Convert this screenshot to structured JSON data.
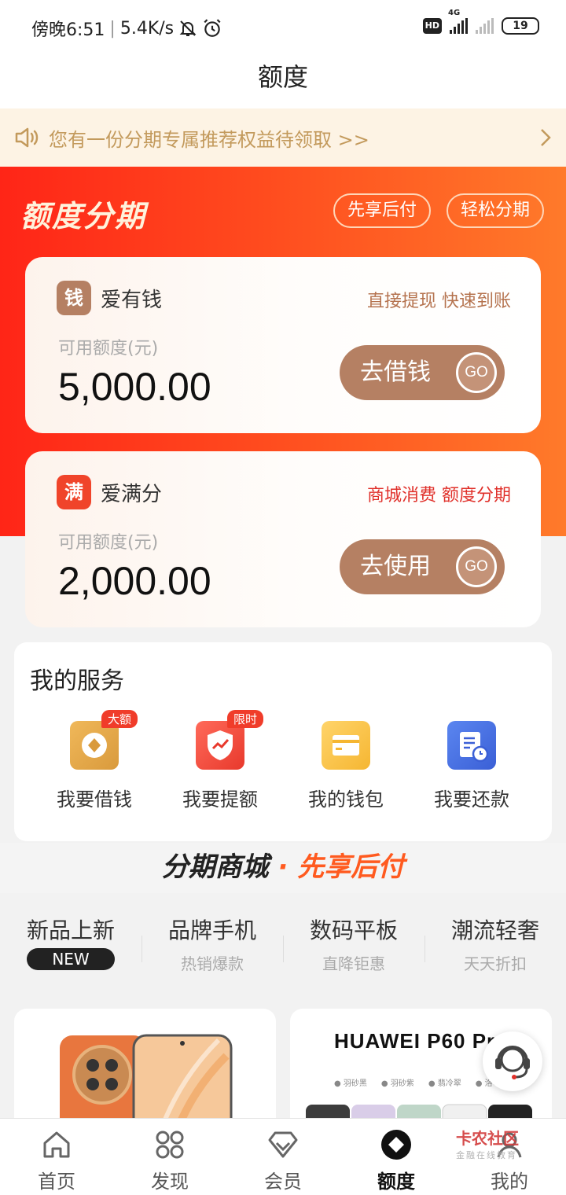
{
  "status_bar": {
    "time": "傍晚6:51",
    "speed": "5.4K/s",
    "network": "4G",
    "hd": "HD",
    "battery": "19"
  },
  "header": {
    "title": "额度"
  },
  "notice": {
    "text": "您有一份分期专属推荐权益待领取 >>"
  },
  "hero": {
    "title": "额度分期",
    "pills": [
      "先享后付",
      "轻松分期"
    ]
  },
  "cards": [
    {
      "logo_char": "钱",
      "name": "爱有钱",
      "tagline": "直接提现 快速到账",
      "label": "可用额度(元)",
      "amount": "5,000.00",
      "button": "去借钱",
      "go": "GO",
      "logo_color": "#b58063",
      "tag_color": "#b5734f"
    },
    {
      "logo_char": "满",
      "name": "爱满分",
      "tagline": "商城消费 额度分期",
      "label": "可用额度(元)",
      "amount": "2,000.00",
      "button": "去使用",
      "go": "GO",
      "logo_color": "#f0442a",
      "tag_color": "#e0302a"
    }
  ],
  "services": {
    "title": "我的服务",
    "items": [
      {
        "label": "我要借钱",
        "badge": "大额",
        "icon": "coin-icon"
      },
      {
        "label": "我要提额",
        "badge": "限时",
        "icon": "shield-up-icon"
      },
      {
        "label": "我的钱包",
        "badge": "",
        "icon": "wallet-icon"
      },
      {
        "label": "我要还款",
        "badge": "",
        "icon": "bill-clock-icon"
      }
    ]
  },
  "mall": {
    "banner_left": "分期商城",
    "banner_dot": "·",
    "banner_right": "先享后付",
    "categories": [
      {
        "title": "新品上新",
        "sub": "NEW"
      },
      {
        "title": "品牌手机",
        "sub": "热销爆款"
      },
      {
        "title": "数码平板",
        "sub": "直降钜惠"
      },
      {
        "title": "潮流轻奢",
        "sub": "天天折扣"
      }
    ],
    "product2_brand": "HUAWEI P60 Pr",
    "product2_colors": [
      "羽砂黑",
      "羽砂紫",
      "翡冷翠",
      "洛可可"
    ]
  },
  "tabbar": {
    "items": [
      {
        "label": "首页",
        "icon": "home-icon"
      },
      {
        "label": "发现",
        "icon": "grid-icon"
      },
      {
        "label": "会员",
        "icon": "diamond-icon"
      },
      {
        "label": "额度",
        "icon": "quota-icon"
      },
      {
        "label": "我的",
        "icon": "profile-icon"
      }
    ],
    "active": "额度"
  },
  "watermark": {
    "title": "卡农社区",
    "sub": "金融在线教育"
  },
  "colors": {
    "hero_start": "#ff2517",
    "hero_end": "#ff7a2a",
    "accent_brown": "#b58063",
    "notice_text": "#c39a5c"
  }
}
